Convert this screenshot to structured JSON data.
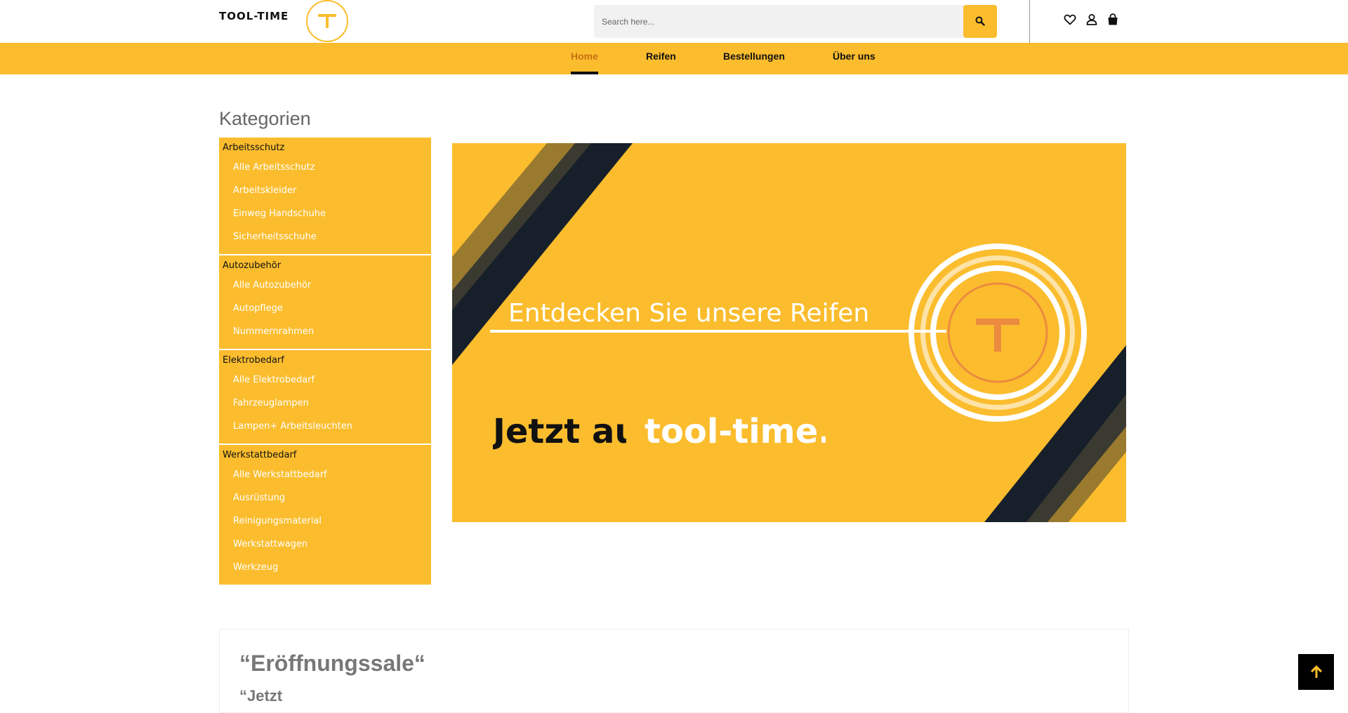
{
  "header": {
    "logo_text": "TOOL-TIME",
    "search_placeholder": "Search here...",
    "icons": [
      "heart-icon",
      "user-icon",
      "shopping-bag-icon",
      "search-icon"
    ]
  },
  "nav": {
    "items": [
      {
        "label": "Home",
        "active": true
      },
      {
        "label": "Reifen",
        "active": false
      },
      {
        "label": "Bestellungen",
        "active": false
      },
      {
        "label": "Über uns",
        "active": false
      }
    ]
  },
  "categories": {
    "title": "Kategorien",
    "groups": [
      {
        "label": "Arbeitsschutz",
        "items": [
          "Alle Arbeitsschutz",
          "Arbeitskleider",
          "Einweg Handschuhe",
          "Sicherheitsschuhe"
        ]
      },
      {
        "label": "Autozubehör",
        "items": [
          "Alle Autozubehör",
          "Autopflege",
          "Nummernrahmen"
        ]
      },
      {
        "label": "Elektrobedarf",
        "items": [
          "Alle Elektrobedarf",
          "Fahrzeuglampen",
          "Lampen+ Arbeitsleuchten"
        ]
      },
      {
        "label": "Werkstattbedarf",
        "items": [
          "Alle Werkstattbedarf",
          "Ausrüstung",
          "Reinigungsmaterial",
          "Werkstattwagen",
          "Werkzeug"
        ]
      }
    ]
  },
  "banner": {
    "headline": "Entdecken Sie unsere Reifen",
    "line1": "Jetzt auf",
    "line2": "tool-time.ch"
  },
  "sale": {
    "title": "“Eröffnungssale“",
    "subtitle": "“Jetzt"
  },
  "colors": {
    "accent": "#fbbd2e",
    "active_nav": "#c96f12",
    "dark_stripe": "#17202a",
    "banner_orange": "#ec8b3f"
  }
}
